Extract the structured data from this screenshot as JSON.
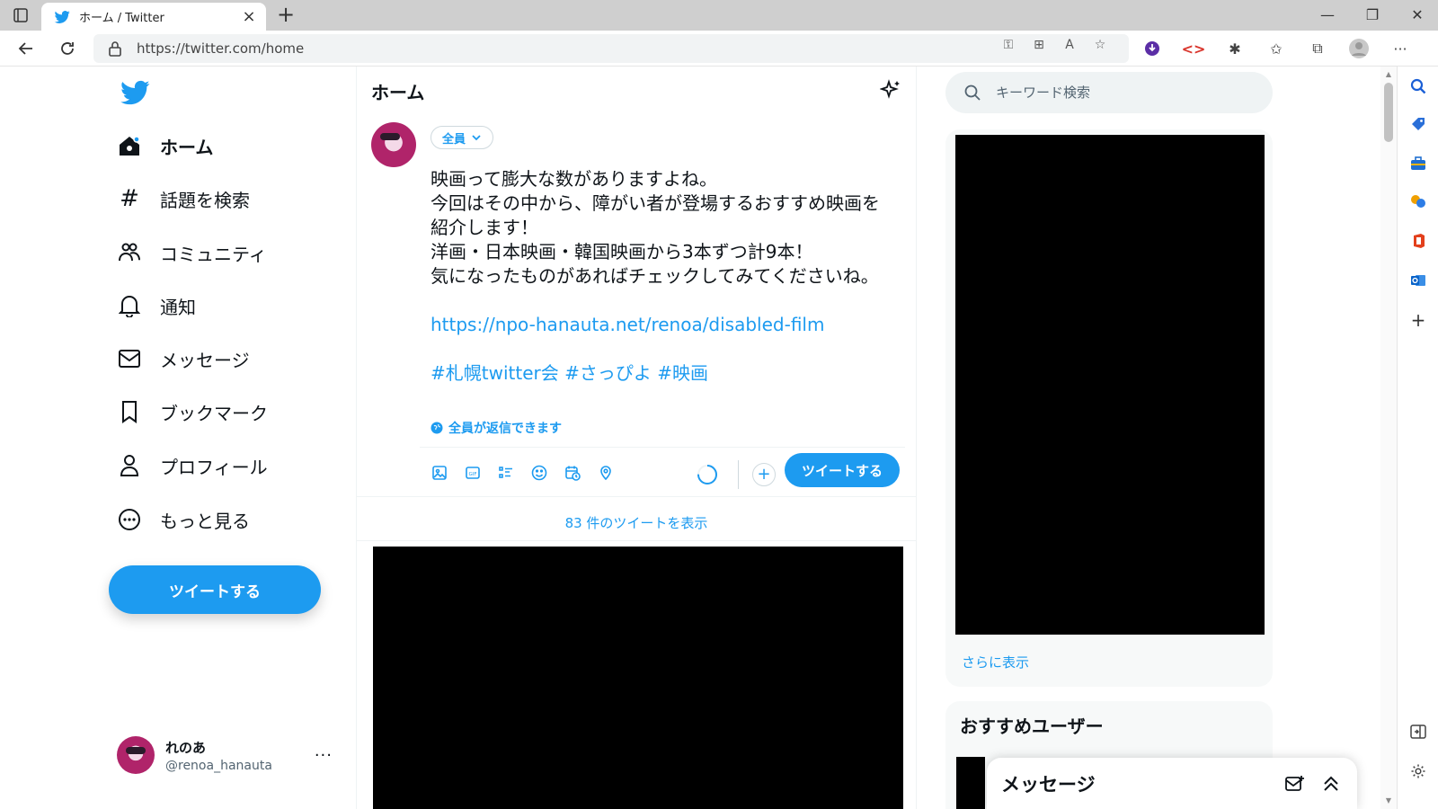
{
  "browser": {
    "tab_title": "ホーム / Twitter",
    "url": "https://twitter.com/home"
  },
  "nav": {
    "items": [
      {
        "label": "ホーム",
        "icon": "home-icon"
      },
      {
        "label": "話題を検索",
        "icon": "hashtag-icon"
      },
      {
        "label": "コミュニティ",
        "icon": "communities-icon"
      },
      {
        "label": "通知",
        "icon": "bell-icon"
      },
      {
        "label": "メッセージ",
        "icon": "envelope-icon"
      },
      {
        "label": "ブックマーク",
        "icon": "bookmark-icon"
      },
      {
        "label": "プロフィール",
        "icon": "person-icon"
      },
      {
        "label": "もっと見る",
        "icon": "more-circle-icon"
      }
    ],
    "tweet_button": "ツイートする",
    "account": {
      "name": "れのあ",
      "handle": "@renoa_hanauta",
      "more": "···"
    }
  },
  "main": {
    "title": "ホーム",
    "compose": {
      "audience": "全員",
      "text_lines": [
        "映画って膨大な数がありますよね。",
        "今回はその中から、障がい者が登場するおすすめ映画を",
        "紹介します！",
        "洋画・日本映画・韓国映画から3本ずつ計9本！",
        "気になったものがあればチェックしてみてくださいね。"
      ],
      "link": "https://npo-hanauta.net/renoa/disabled-film",
      "hashtags": "#札幌twitter会 #さっぴよ #映画",
      "reply_setting": "全員が返信できます",
      "tweet_button": "ツイートする",
      "progress": 0.75
    },
    "show_new": "83 件のツイートを表示"
  },
  "right": {
    "search_placeholder": "キーワード検索",
    "more_link": "さらに表示",
    "users_title": "おすすめユーザー"
  },
  "messages_drawer": {
    "title": "メッセージ"
  },
  "colors": {
    "accent": "#1d9bf0",
    "text": "#0f1419"
  }
}
